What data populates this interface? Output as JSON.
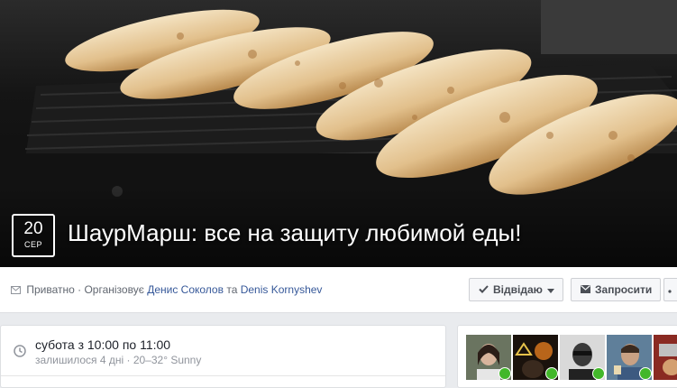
{
  "event": {
    "day": "20",
    "month": "СЕР",
    "title": "ШаурМарш: все на защиту любимой еды!"
  },
  "meta": {
    "privacy": "Приватно",
    "organized_by": "· Організовує",
    "host1": "Денис Соколов",
    "and": "та",
    "host2": "Denis Kornyshev"
  },
  "actions": {
    "going_label": "Відвідаю",
    "invite_label": "Запросити"
  },
  "details": {
    "time": "субота з 10:00 по 11:00",
    "subline": "залишилося 4 дні · 20–32° Sunny"
  },
  "friends": [
    {
      "name": "friend-avatar-1"
    },
    {
      "name": "friend-avatar-2"
    },
    {
      "name": "friend-avatar-3"
    },
    {
      "name": "friend-avatar-4"
    },
    {
      "name": "friend-avatar-5"
    }
  ],
  "colors": {
    "link": "#365899",
    "going_check": "#42b72a",
    "page_bg": "#e9ebee"
  }
}
